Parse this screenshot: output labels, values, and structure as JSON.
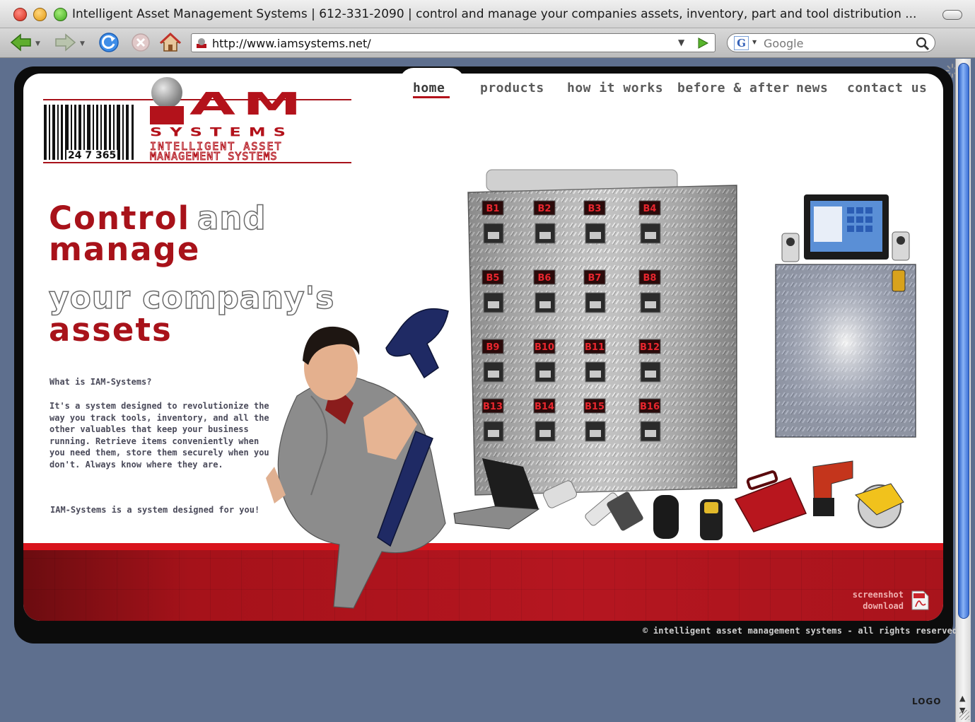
{
  "browser": {
    "window_title": "Intelligent Asset Management Systems | 612-331-2090 | control and manage your companies assets, inventory, part and tool distribution ...",
    "url": "http://www.iamsystems.net/",
    "search_engine": "Google",
    "search_badge": "G"
  },
  "logo": {
    "barcode_number": "24 7 365",
    "mark": "AM",
    "word": "SYSTEMS",
    "tagline_line1": "INTELLIGENT ASSET",
    "tagline_line2": "MANAGEMENT SYSTEMS"
  },
  "nav": {
    "home": "home",
    "products": "products",
    "how_it_works": "how it works",
    "before_after": "before & after",
    "news": "news",
    "contact_us": "contact us"
  },
  "headline": {
    "control": "Control",
    "and": "and",
    "manage": "manage",
    "your_companys": "your company's",
    "assets": "assets"
  },
  "intro": {
    "question": "What is IAM-Systems?",
    "paragraph": "It's a system designed to revolutionize the way you track tools, inventory, and all the other valuables that keep your business running.  Retrieve items conveniently when you need them, store them securely when you don't.  Always know where they are.",
    "tagline": "IAM-Systems is a system designed for you!"
  },
  "locker_labels": [
    "B1",
    "B2",
    "B3",
    "B4",
    "B5",
    "B6",
    "B7",
    "B8",
    "B9",
    "B10",
    "B11",
    "B12",
    "B13",
    "B14",
    "B15",
    "B16"
  ],
  "footer": {
    "screenshot_line1": "screenshot",
    "screenshot_line2": "download",
    "copyright": "© intelligent asset management systems - all rights reserved",
    "corner_logo": "LOGO"
  },
  "colors": {
    "brand_red": "#b3121b",
    "page_background": "#5e6f8e",
    "frame": "#0c0c0c"
  }
}
